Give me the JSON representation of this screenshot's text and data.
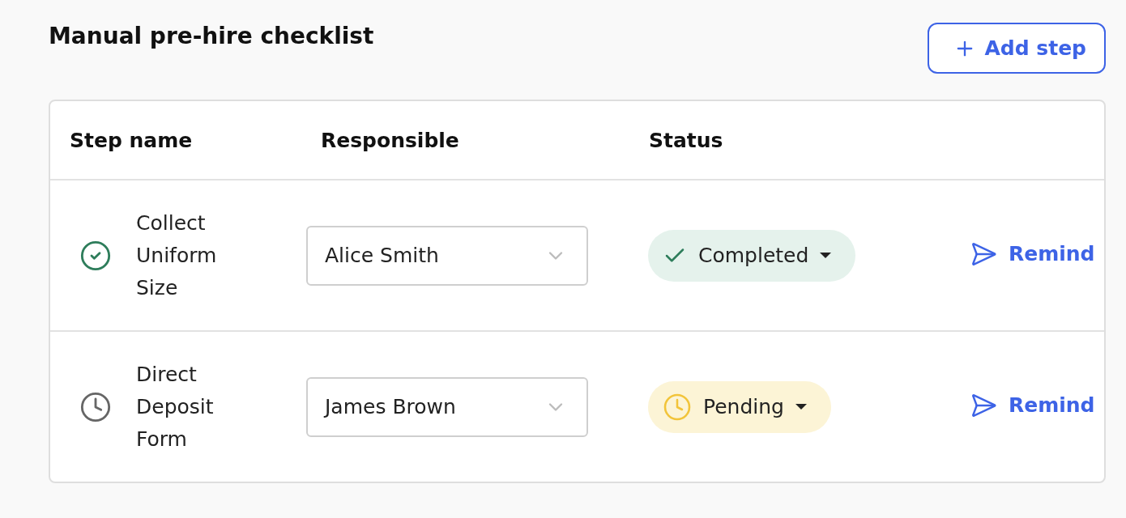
{
  "title": "Manual pre-hire checklist",
  "add_button": {
    "label": "Add step"
  },
  "table": {
    "columns": [
      "Step name",
      "Responsible",
      "Status"
    ],
    "rows": [
      {
        "kind": "completed",
        "name": "Collect Uniform Size",
        "responsible": "Alice Smith",
        "status": "Completed",
        "action": "Remind"
      },
      {
        "kind": "pending",
        "name": "Direct Deposit Form",
        "responsible": "James Brown",
        "status": "Pending",
        "action": "Remind"
      }
    ]
  }
}
